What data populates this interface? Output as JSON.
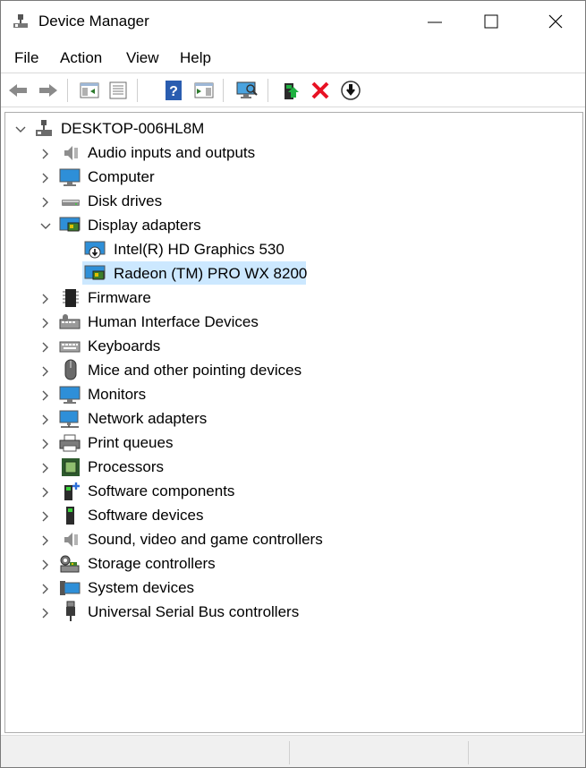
{
  "window": {
    "title": "Device Manager"
  },
  "menu": {
    "file": "File",
    "action": "Action",
    "view": "View",
    "help": "Help"
  },
  "toolbar": {
    "icons": [
      "back-arrow-icon",
      "forward-arrow-icon",
      "show-hide-console-tree-icon",
      "properties-icon",
      "help-icon",
      "action-pane-icon",
      "scan-hardware-icon",
      "update-driver-icon",
      "uninstall-device-icon",
      "disable-device-icon"
    ]
  },
  "tree": {
    "root": "DESKTOP-006HL8M",
    "categories": [
      {
        "label": "Audio inputs and outputs",
        "icon": "speaker-icon"
      },
      {
        "label": "Computer",
        "icon": "computer-icon"
      },
      {
        "label": "Disk drives",
        "icon": "disk-drive-icon"
      },
      {
        "label": "Display adapters",
        "icon": "display-adapter-icon"
      },
      {
        "label": "Intel(R) HD Graphics 530",
        "icon": "display-adapter-disabled-icon"
      },
      {
        "label": "Radeon (TM) PRO WX 8200",
        "icon": "display-adapter-icon"
      },
      {
        "label": "Firmware",
        "icon": "firmware-chip-icon"
      },
      {
        "label": "Human Interface Devices",
        "icon": "hid-icon"
      },
      {
        "label": "Keyboards",
        "icon": "keyboard-icon"
      },
      {
        "label": "Mice and other pointing devices",
        "icon": "mouse-icon"
      },
      {
        "label": "Monitors",
        "icon": "monitor-icon"
      },
      {
        "label": "Network adapters",
        "icon": "network-adapter-icon"
      },
      {
        "label": "Print queues",
        "icon": "printer-icon"
      },
      {
        "label": "Processors",
        "icon": "processor-icon"
      },
      {
        "label": "Software components",
        "icon": "software-component-icon"
      },
      {
        "label": "Software devices",
        "icon": "software-device-icon"
      },
      {
        "label": "Sound, video and game controllers",
        "icon": "speaker-icon"
      },
      {
        "label": "Storage controllers",
        "icon": "storage-controller-icon"
      },
      {
        "label": "System devices",
        "icon": "system-devices-icon"
      },
      {
        "label": "Universal Serial Bus controllers",
        "icon": "usb-icon"
      }
    ]
  },
  "colors": {
    "selection": "#cce8ff",
    "accent": "#0078d7"
  }
}
